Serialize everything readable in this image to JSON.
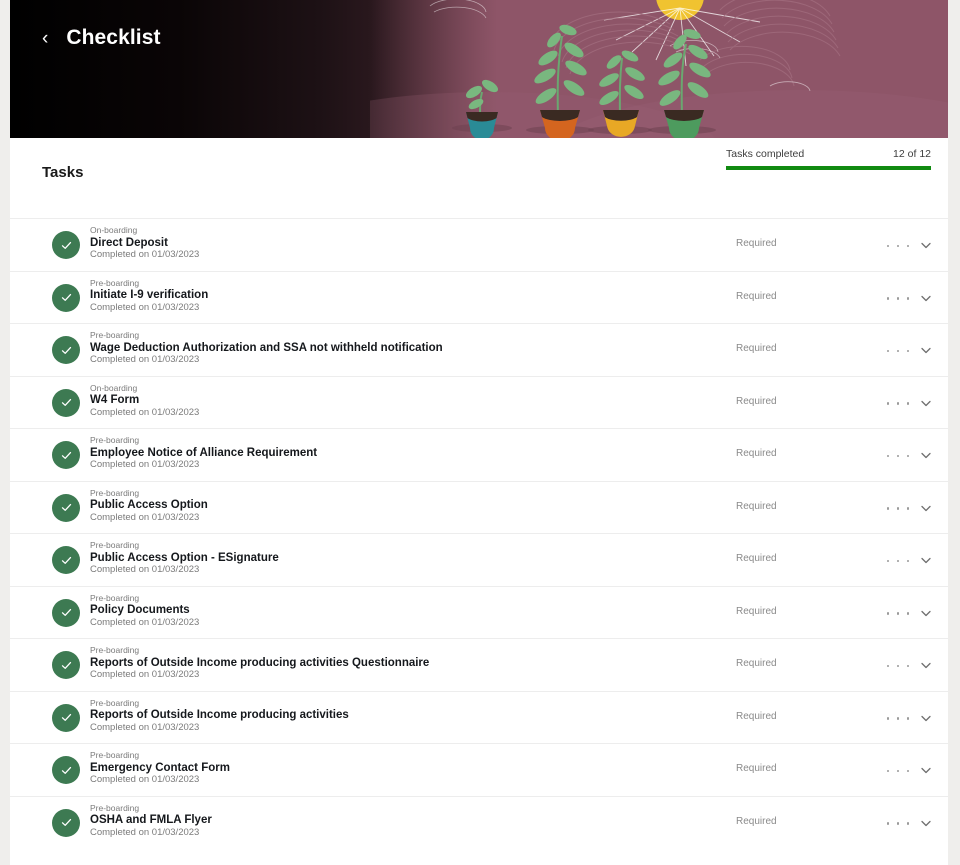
{
  "header": {
    "back_icon": "chevron-left-icon",
    "title": "Checklist",
    "illustration": {
      "name": "growing-plants-illustration",
      "background_color": "#8e5568",
      "sun_color": "#f0c330",
      "pots": [
        {
          "color": "#2a8b96",
          "label": "teal-pot"
        },
        {
          "color": "#d4651f",
          "label": "orange-pot"
        },
        {
          "color": "#e8a825",
          "label": "amber-pot"
        },
        {
          "color": "#4d9b5e",
          "label": "green-pot"
        }
      ],
      "leaf_color": "#79b77f"
    }
  },
  "tasks_section": {
    "title": "Tasks",
    "progress": {
      "label": "Tasks completed",
      "count_text": "12 of 12",
      "completed": 12,
      "total": 12,
      "percent": 100,
      "bar_color": "#118a11",
      "track_color": "#e3e3e3"
    },
    "row_controls": {
      "menu_icon": "ellipsis-horizontal-icon",
      "expand_icon": "chevron-down-icon"
    },
    "status_icon": "check-circle-icon",
    "status_icon_color": "#3d7a52",
    "items": [
      {
        "kind": "On-boarding",
        "name": "Direct Deposit",
        "status": "Completed on 01/03/2023",
        "requirement": "Required"
      },
      {
        "kind": "Pre-boarding",
        "name": "Initiate I-9 verification",
        "status": "Completed on 01/03/2023",
        "requirement": "Required"
      },
      {
        "kind": "Pre-boarding",
        "name": "Wage Deduction Authorization and SSA not withheld notification",
        "status": "Completed on 01/03/2023",
        "requirement": "Required"
      },
      {
        "kind": "On-boarding",
        "name": "W4 Form",
        "status": "Completed on 01/03/2023",
        "requirement": "Required"
      },
      {
        "kind": "Pre-boarding",
        "name": "Employee Notice of Alliance Requirement",
        "status": "Completed on 01/03/2023",
        "requirement": "Required"
      },
      {
        "kind": "Pre-boarding",
        "name": "Public Access Option",
        "status": "Completed on 01/03/2023",
        "requirement": "Required"
      },
      {
        "kind": "Pre-boarding",
        "name": "Public Access Option - ESignature",
        "status": "Completed on 01/03/2023",
        "requirement": "Required"
      },
      {
        "kind": "Pre-boarding",
        "name": "Policy Documents",
        "status": "Completed on 01/03/2023",
        "requirement": "Required"
      },
      {
        "kind": "Pre-boarding",
        "name": "Reports of Outside Income producing activities Questionnaire",
        "status": "Completed on 01/03/2023",
        "requirement": "Required"
      },
      {
        "kind": "Pre-boarding",
        "name": "Reports of Outside Income producing activities",
        "status": "Completed on 01/03/2023",
        "requirement": "Required"
      },
      {
        "kind": "Pre-boarding",
        "name": "Emergency Contact Form",
        "status": "Completed on 01/03/2023",
        "requirement": "Required"
      },
      {
        "kind": "Pre-boarding",
        "name": "OSHA and FMLA Flyer",
        "status": "Completed on 01/03/2023",
        "requirement": "Required"
      }
    ]
  }
}
